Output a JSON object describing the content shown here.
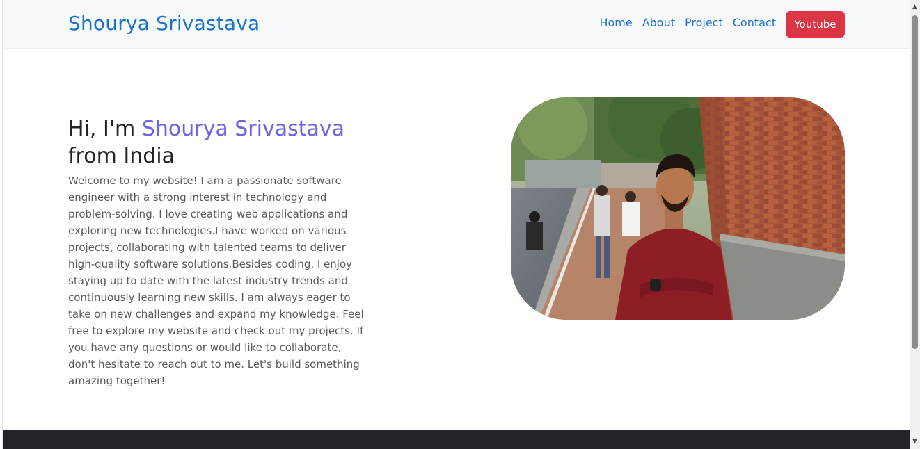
{
  "navbar": {
    "brand": "Shourya Srivastava",
    "links": [
      "Home",
      "About",
      "Project",
      "Contact"
    ],
    "youtube_label": "Youtube"
  },
  "hero": {
    "greeting": "Hi, I'm ",
    "name": "Shourya Srivastava",
    "origin": "from India",
    "description": "Welcome to my website! I am a passionate software engineer with a strong interest in technology and problem-solving. I love creating web applications and exploring new technologies.I have worked on various projects, collaborating with talented teams to deliver high-quality software solutions.Besides coding, I enjoy staying up to date with the latest industry trends and continuously learning new skills. I am always eager to take on new challenges and expand my knowledge. Feel free to explore my website and check out my projects. If you have any questions or would like to collaborate, don't hesitate to reach out to me. Let's build something amazing together!"
  },
  "photo": {
    "alt": "portrait-photo"
  },
  "colors": {
    "brand": "#1a73c9",
    "accent": "#6c63e6",
    "youtube": "#dc3545",
    "footer": "#212529",
    "navbar_bg": "#f8f9fa"
  },
  "scrollbar": {
    "up_icon": "triangle-up-icon",
    "down_icon": "triangle-down-icon"
  }
}
